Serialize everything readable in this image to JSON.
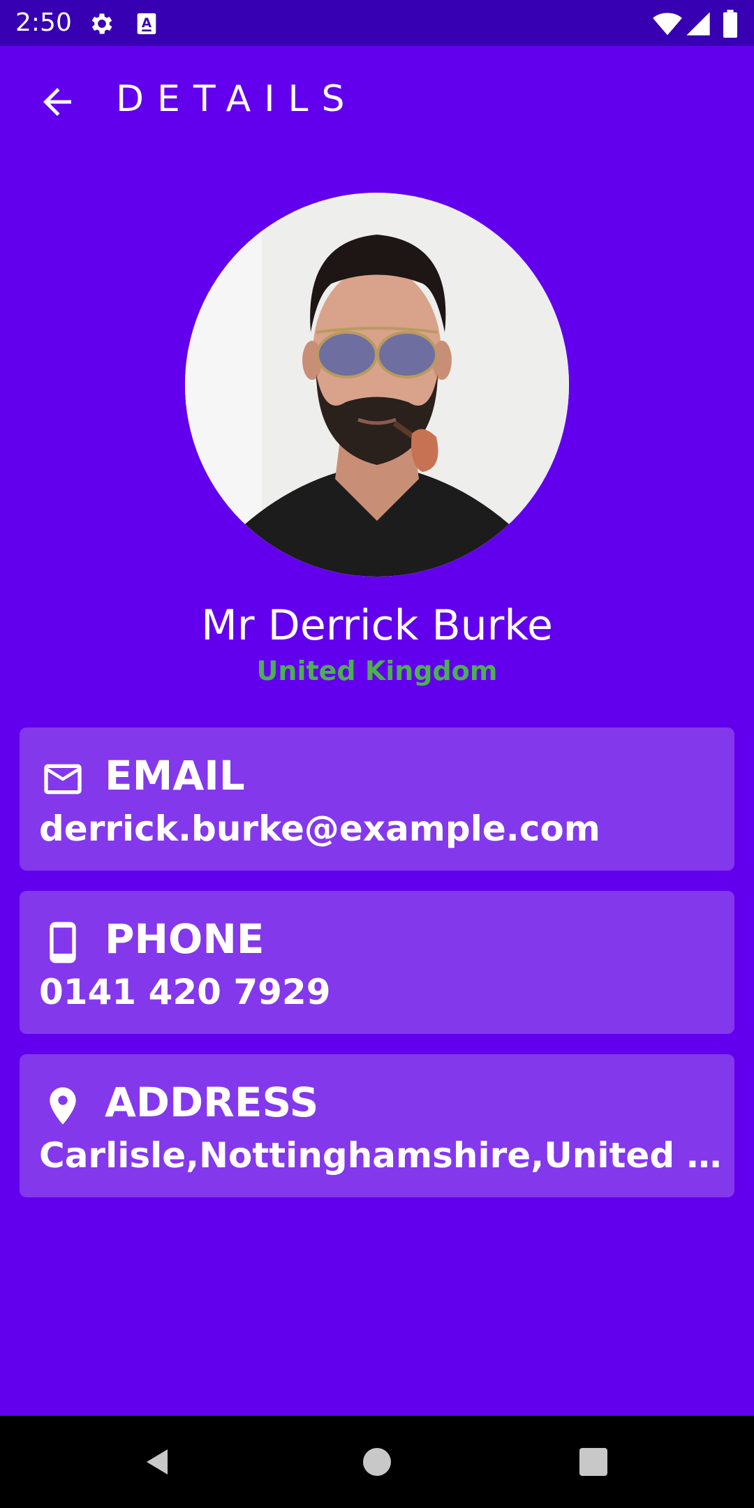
{
  "status_bar": {
    "time": "2:50",
    "icons": [
      "gear-icon",
      "keyboard-a-icon",
      "wifi-icon",
      "signal-icon",
      "battery-icon"
    ]
  },
  "toolbar": {
    "title": "DETAILS",
    "back_icon": "arrow-left-icon"
  },
  "profile": {
    "name": "Mr Derrick Burke",
    "country": "United Kingdom"
  },
  "cards": {
    "email": {
      "icon": "mail-icon",
      "label": "EMAIL",
      "value": "derrick.burke@example.com"
    },
    "phone": {
      "icon": "phone-icon",
      "label": "PHONE",
      "value": "0141 420 7929"
    },
    "address": {
      "icon": "location-pin-icon",
      "label": "ADDRESS",
      "value": "Carlisle,Nottinghamshire,United Kingdom"
    }
  },
  "nav_bar": {
    "icons": [
      "back-triangle-icon",
      "home-circle-icon",
      "recents-square-icon"
    ]
  },
  "colors": {
    "background": "#6200EE",
    "status_bar": "#3700B3",
    "card": "#8338EC",
    "country_text": "#4CAF50"
  }
}
